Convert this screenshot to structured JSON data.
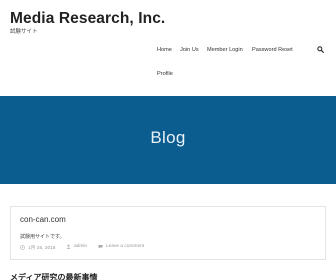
{
  "site": {
    "title": "Media Research, Inc.",
    "tagline": "試験サイト"
  },
  "nav": {
    "items": [
      {
        "label": "Home"
      },
      {
        "label": "Join Us"
      },
      {
        "label": "Member Login"
      },
      {
        "label": "Password Reset"
      },
      {
        "label": "Profile"
      }
    ],
    "search_icon": "search-icon"
  },
  "hero": {
    "title": "Blog",
    "background": "#0a5d8e"
  },
  "posts": [
    {
      "title": "con-can.com",
      "excerpt": "試験用サイトです。",
      "date": "1月 25, 2018",
      "author": "admin",
      "comments": "Leave a comment"
    }
  ],
  "next_post": {
    "title": "メディア研究の最新事情"
  }
}
